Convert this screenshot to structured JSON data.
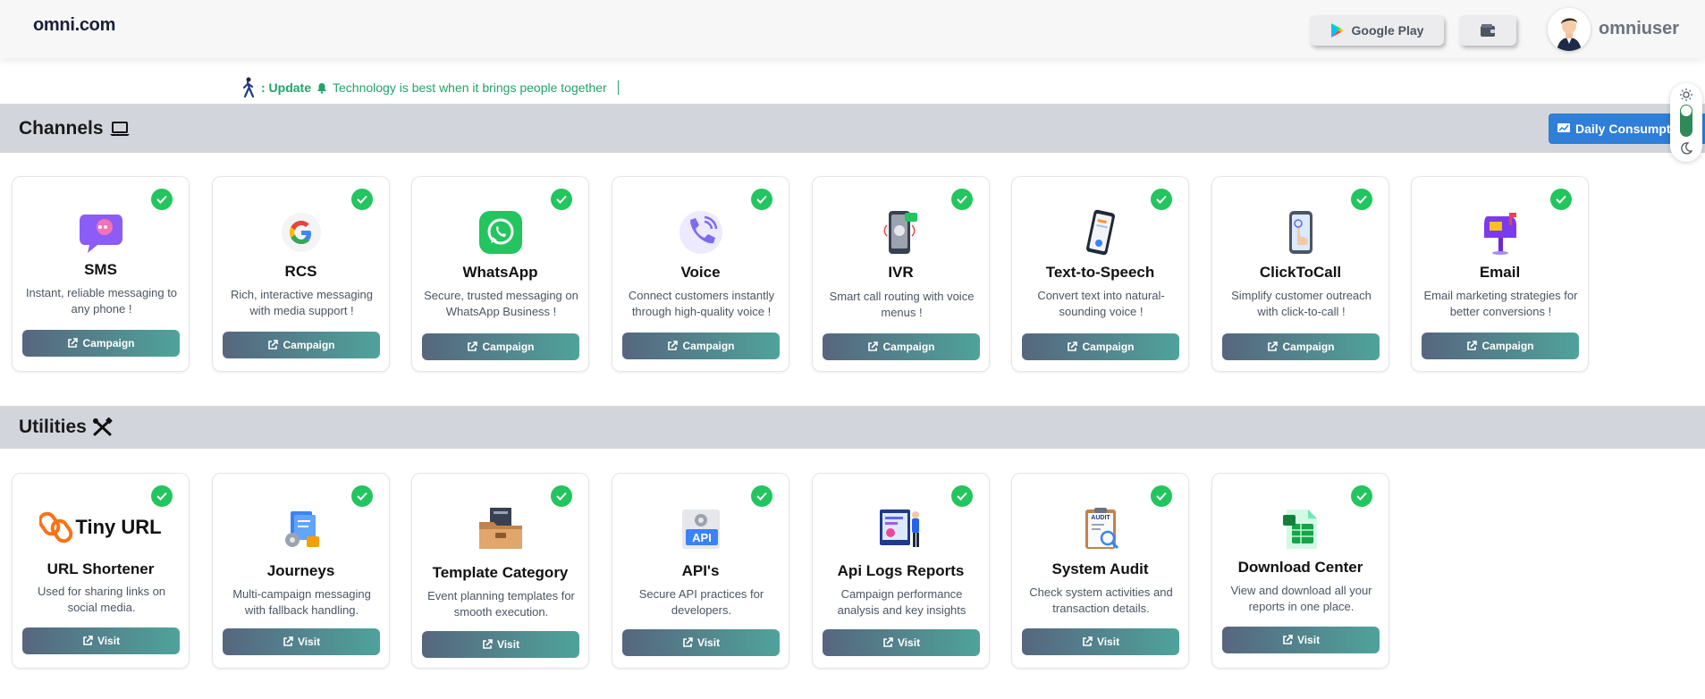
{
  "header": {
    "logo": "omni.com",
    "google_play_label": "Google Play",
    "username": "omniuser"
  },
  "ticker": {
    "prefix": ": Update",
    "message": "Technology is best when it brings people together"
  },
  "channels": {
    "title": "Channels",
    "daily_label": "Daily Consumpti",
    "cards": [
      {
        "title": "SMS",
        "desc": "Instant, reliable messaging to any phone !",
        "button": "Campaign",
        "icon": "sms-chat-icon"
      },
      {
        "title": "RCS",
        "desc": "Rich, interactive messaging with media support !",
        "button": "Campaign",
        "icon": "google-g-icon"
      },
      {
        "title": "WhatsApp",
        "desc": "Secure, trusted messaging on WhatsApp Business !",
        "button": "Campaign",
        "icon": "whatsapp-icon"
      },
      {
        "title": "Voice",
        "desc": "Connect customers instantly through high-quality voice !",
        "button": "Campaign",
        "icon": "phone-call-icon"
      },
      {
        "title": "IVR",
        "desc": "Smart call routing with voice menus !",
        "button": "Campaign",
        "icon": "ivr-phone-icon"
      },
      {
        "title": "Text-to-Speech",
        "desc": "Convert text into natural-sounding voice !",
        "button": "Campaign",
        "icon": "text-to-speech-phone-icon"
      },
      {
        "title": "ClickToCall",
        "desc": "Simplify customer outreach with click-to-call !",
        "button": "Campaign",
        "icon": "click-phone-icon"
      },
      {
        "title": "Email",
        "desc": "Email marketing strategies for better conversions !",
        "button": "Campaign",
        "icon": "mailbox-icon"
      }
    ]
  },
  "utilities": {
    "title": "Utilities",
    "cards": [
      {
        "title": "URL Shortener",
        "desc": "Used for sharing links on social media.",
        "button": "Visit",
        "icon": "tiny-url-logo",
        "logo_text": "Tiny URL"
      },
      {
        "title": "Journeys",
        "desc": "Multi-campaign messaging with fallback handling.",
        "button": "Visit",
        "icon": "journeys-gear-icon"
      },
      {
        "title": "Template Category",
        "desc": "Event planning templates for smooth execution.",
        "button": "Visit",
        "icon": "folder-icon"
      },
      {
        "title": "API's",
        "desc": "Secure API practices for developers.",
        "button": "Visit",
        "icon": "api-icon",
        "icon_text": "API"
      },
      {
        "title": "Api Logs Reports",
        "desc": "Campaign performance analysis and key insights",
        "button": "Visit",
        "icon": "reports-presenter-icon"
      },
      {
        "title": "System Audit",
        "desc": "Check system activities and transaction details.",
        "button": "Visit",
        "icon": "audit-clipboard-icon",
        "icon_text": "AUDIT"
      },
      {
        "title": "Download Center",
        "desc": "View and download all your reports in one place.",
        "button": "Visit",
        "icon": "excel-file-icon"
      }
    ]
  },
  "colors": {
    "check": "#22c55e",
    "button_start": "#56667e",
    "button_end": "#4fa39b",
    "daily_button": "#2f7ed8",
    "ticker": "#22a36b"
  }
}
